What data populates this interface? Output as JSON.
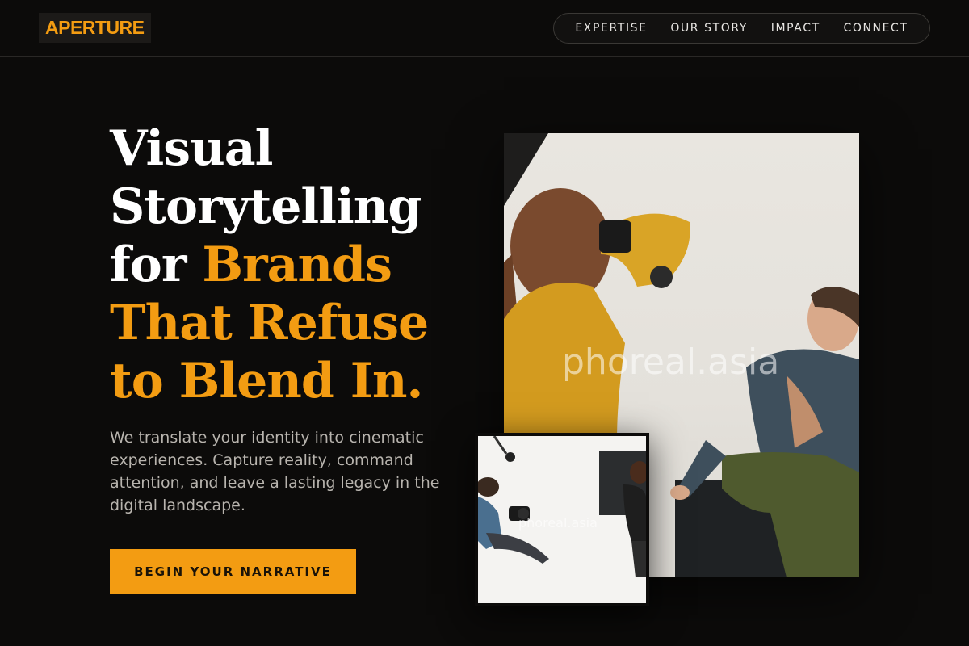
{
  "header": {
    "logo": "APERTURE",
    "nav": [
      {
        "label": "EXPERTISE"
      },
      {
        "label": "OUR STORY"
      },
      {
        "label": "IMPACT"
      },
      {
        "label": "CONNECT"
      }
    ]
  },
  "hero": {
    "headline_line1": "Visual",
    "headline_line2": "Storytelling",
    "headline_line3_plain": "for ",
    "headline_line3_accent": "Brands",
    "headline_line4": "That Refuse",
    "headline_line5": "to Blend In.",
    "lead": "We translate your identity into cinematic experiences. Capture reality, command attention, and leave a lasting legacy in the digital landscape.",
    "cta_label": "BEGIN YOUR NARRATIVE"
  },
  "media": {
    "main_watermark": "phoreal.asia",
    "small_watermark": "phoreal.asia"
  },
  "colors": {
    "background": "#0c0b0a",
    "accent": "#f39c12",
    "text": "#ffffff",
    "muted_text": "#b8b4ae"
  }
}
